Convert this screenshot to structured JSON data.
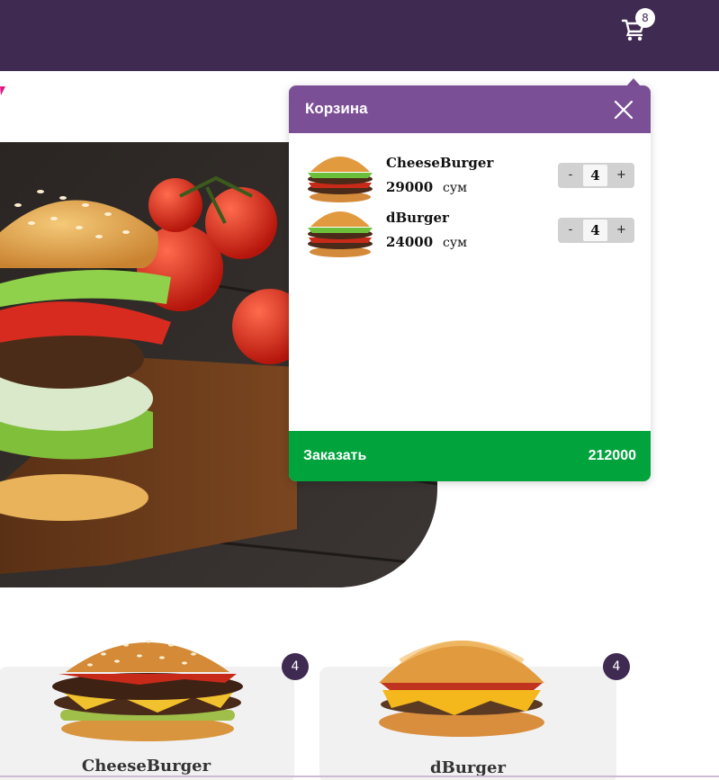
{
  "header": {
    "cart_count": "8",
    "cart_icon": "shopping-cart-icon",
    "bg_color": "#3f2a52"
  },
  "hero": {
    "image": "burger-with-tomatoes-on-wooden-board"
  },
  "cart_popup": {
    "title": "Корзина",
    "close_icon": "close-icon",
    "items": [
      {
        "name": "CheeseBurger",
        "price": "29000",
        "currency": "сум",
        "qty": "4",
        "minus": "-",
        "plus": "+"
      },
      {
        "name": "dBurger",
        "price": "24000",
        "currency": "сум",
        "qty": "4",
        "minus": "-",
        "plus": "+"
      }
    ],
    "order_label": "Заказать",
    "order_total": "212000",
    "header_color": "#7b4f96",
    "order_color": "#00a33c"
  },
  "products": [
    {
      "name": "CheeseBurger",
      "count": "4"
    },
    {
      "name": "dBurger",
      "count": "4"
    }
  ]
}
